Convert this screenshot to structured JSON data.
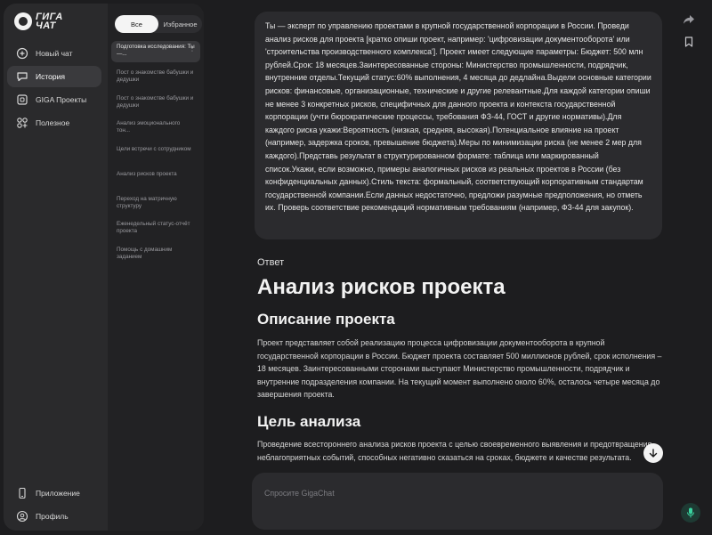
{
  "app": {
    "logo_text": "ГИГА ЧАТ"
  },
  "nav": {
    "items": [
      {
        "label": "Новый чат",
        "icon": "new-chat-icon"
      },
      {
        "label": "История",
        "icon": "history-icon"
      },
      {
        "label": "GIGA Проекты",
        "icon": "projects-icon"
      },
      {
        "label": "Полезное",
        "icon": "useful-icon"
      }
    ],
    "bottom": [
      {
        "label": "Приложение",
        "icon": "phone-icon"
      },
      {
        "label": "Профиль",
        "icon": "profile-icon"
      }
    ]
  },
  "tabs": {
    "all": "Все",
    "favorites": "Избранное"
  },
  "history": [
    "Подготовка исследования: Ты —...",
    "Пост о знакомстве бабушки и дедушки",
    "Пост о знакомстве бабушки и дедушки",
    "Анализ эмоционального тон...",
    "Цели встречи с сотрудником",
    "Анализ рисков проекта",
    "Переход на матричную структуру",
    "Еженедельный статус-отчёт проекта",
    "Помощь с домашним заданием"
  ],
  "user_message": "Ты — эксперт по управлению проектами в крупной государственной корпорации в России. Проведи анализ рисков для проекта [кратко опиши проект, например: 'цифровизации документооборота' или 'строительства производственного комплекса']. Проект имеет следующие параметры: Бюджет: 500 млн рублей.Срок: 18 месяцев.Заинтересованные стороны:  Министерство промышленности, подрядчик, внутренние отделы.Текущий статус:60% выполнения, 4 месяца до дедлайна.Выдели основные категории рисков: финансовые, организационные, технические и другие релевантные.Для каждой категории опиши не менее 3 конкретных рисков, специфичных для данного проекта и контекста государственной корпорации (учти бюрократические процессы, требования ФЗ-44, ГОСТ и другие нормативы).Для каждого риска укажи:Вероятность (низкая, средняя, высокая).Потенциальное влияние на проект (например, задержка сроков, превышение бюджета).Меры по минимизации риска (не менее 2 мер для каждого).Представь результат в структурированном формате: таблица или маркированный список.Укажи, если возможно, примеры аналогичных рисков из реальных проектов в России (без конфиденциальных данных).Стиль текста: формальный, соответствующий корпоративным стандартам государственной компании.Если данных недостаточно, предложи разумные предположения, но отметь их. Проверь соответствие рекомендаций нормативным требованиям (например, ФЗ-44 для закупок).",
  "answer": {
    "label": "Ответ",
    "title": "Анализ рисков проекта",
    "sections": [
      {
        "heading": "Описание проекта",
        "text": "Проект представляет собой реализацию процесса цифровизации документооборота в крупной государственной корпорации в России. Бюджет проекта составляет 500 миллионов рублей, срок исполнения – 18 месяцев. Заинтересованными сторонами выступают Министерство промышленности, подрядчик и внутренние подразделения компании. На текущий момент выполнено около 60%, осталось четыре месяца до завершения проекта."
      },
      {
        "heading": "Цель анализа",
        "text": "Проведение всестороннего анализа рисков проекта с целью своевременного выявления и предотвращения неблагоприятных событий, способных негативно сказаться на сроках, бюджете и качестве результата."
      }
    ]
  },
  "input": {
    "placeholder": "Спросите GigaChat"
  },
  "colors": {
    "background": "#1d1d1f",
    "panel": "#2a2a2c",
    "accent_mic": "#3ad4a0"
  }
}
